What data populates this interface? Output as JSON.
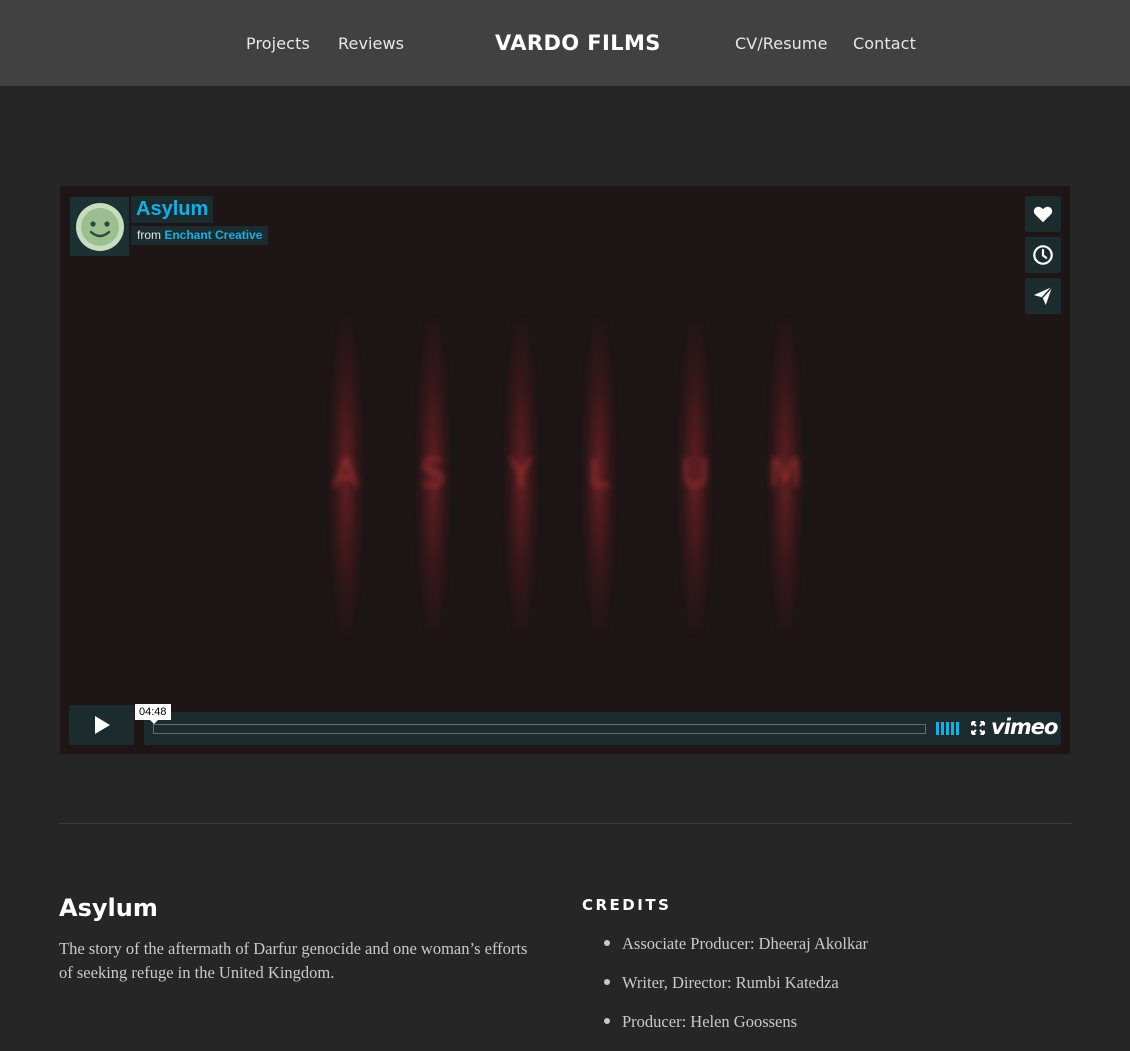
{
  "nav": {
    "left_links": [
      "Projects",
      "Reviews"
    ],
    "brand": "VARDO FILMS",
    "right_links": [
      "CV/Resume",
      "Contact"
    ]
  },
  "player": {
    "title": "Asylum",
    "from_prefix": "from",
    "author": "Enchant Creative",
    "timecode": "04:48",
    "progress": 0,
    "logo_text": "vimeo",
    "accent_color": "#19aee3",
    "overlay_letters": [
      "A",
      "S",
      "Y",
      "L",
      "U",
      "M"
    ],
    "side_actions": [
      {
        "name": "like",
        "icon": "heart-icon"
      },
      {
        "name": "watch-later",
        "icon": "clock-icon"
      },
      {
        "name": "share",
        "icon": "paper-plane-icon"
      }
    ]
  },
  "project": {
    "title": "Asylum",
    "description": "The story of the aftermath of Darfur genocide and one woman’s efforts of seeking refuge in the United Kingdom."
  },
  "credits": {
    "heading": "CREDITS",
    "items": [
      "Associate Producer: Dheeraj Akolkar",
      "Writer, Director: Rumbi Katedza",
      "Producer: Helen Goossens"
    ]
  }
}
